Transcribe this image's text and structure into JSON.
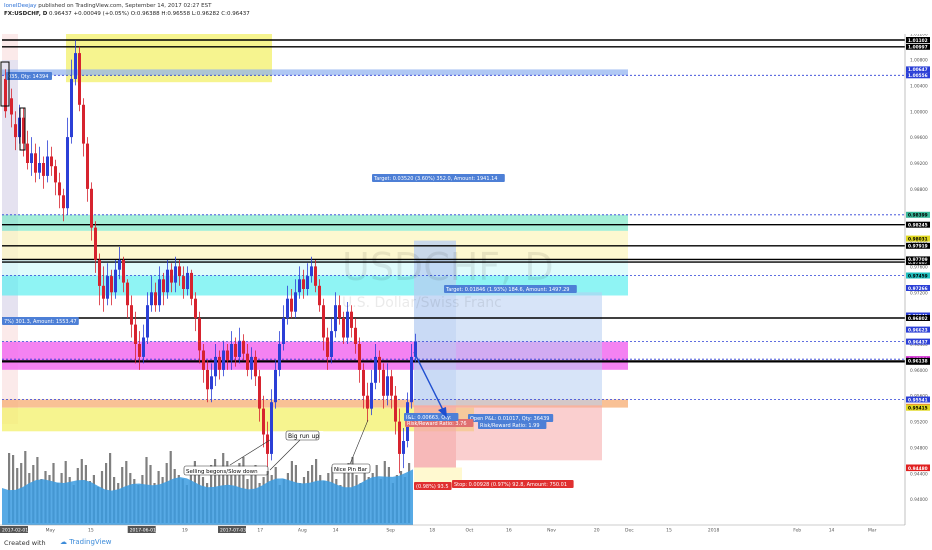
{
  "header": {
    "author": "IonelDeejay",
    "published_text": "published on TradingView.com, September 14, 2017 02:27 EST",
    "symbol_line": "FX:USDCHF, D",
    "open": "0.96437",
    "change": "+0.00049 (+0.05%)",
    "ohlc_open": "O:0.96388",
    "ohlc_high": "H:0.96558",
    "ohlc_low": "L:0.96282",
    "ohlc_close": "C:0.96437"
  },
  "watermark": {
    "symbol": "USDCHF, D",
    "name": "U.S. Dollar/Swiss Franc"
  },
  "chart_data": {
    "type": "candlestick",
    "symbol": "FX:USDCHF",
    "timeframe": "D",
    "y_range": [
      0.936,
      1.0135
    ],
    "y_ticks": [
      "1.01200",
      "1.00800",
      "1.00400",
      "1.00000",
      "0.99600",
      "0.99200",
      "0.98800",
      "0.98400",
      "0.98000",
      "0.97600",
      "0.97200",
      "0.96800",
      "0.96400",
      "0.96000",
      "0.95600",
      "0.95200",
      "0.94800",
      "0.94400",
      "0.94000"
    ],
    "x_ticks": [
      {
        "label": "2017-02-01",
        "pos": 0.0
      },
      {
        "label": "May",
        "pos": 0.07
      },
      {
        "label": "15",
        "pos": 0.138
      },
      {
        "label": "2017-06-01",
        "pos": 0.205
      },
      {
        "label": "19",
        "pos": 0.289
      },
      {
        "label": "2017-07-03",
        "pos": 0.35
      },
      {
        "label": "17",
        "pos": 0.41
      },
      {
        "label": "Aug",
        "pos": 0.475
      },
      {
        "label": "14",
        "pos": 0.531
      },
      {
        "label": "Sep",
        "pos": 0.617
      },
      {
        "label": "18",
        "pos": 0.686
      },
      {
        "label": "Oct",
        "pos": 0.744
      },
      {
        "label": "16",
        "pos": 0.809
      },
      {
        "label": "Nov",
        "pos": 0.875
      },
      {
        "label": "20",
        "pos": 0.95
      },
      {
        "label": "Dec",
        "pos": 1.0
      },
      {
        "label": "15",
        "pos": 1.066
      },
      {
        "label": "2018",
        "pos": 1.133
      },
      {
        "label": "Feb",
        "pos": 1.27
      },
      {
        "label": "14",
        "pos": 1.327
      },
      {
        "label": "Mar",
        "pos": 1.39
      }
    ],
    "price_labels": [
      {
        "value": "1.01102",
        "level": 1.01102,
        "style": "black"
      },
      {
        "value": "1.00997",
        "level": 1.00997,
        "style": "black"
      },
      {
        "value": "1.00647",
        "level": 1.00647,
        "style": "blue"
      },
      {
        "value": "1.00556",
        "level": 1.00556,
        "style": "blue"
      },
      {
        "value": "0.98399",
        "level": 0.98399,
        "style": "teal"
      },
      {
        "value": "0.98245",
        "level": 0.98245,
        "style": "black"
      },
      {
        "value": "0.98031",
        "level": 0.98031,
        "style": "yellow"
      },
      {
        "value": "0.97919",
        "level": 0.97919,
        "style": "black"
      },
      {
        "value": "0.97667",
        "level": 0.97667,
        "style": "black"
      },
      {
        "value": "0.96164",
        "level": 0.96164,
        "style": "magenta"
      },
      {
        "value": "0.96125",
        "level": 0.96125,
        "style": "black"
      },
      {
        "value": "0.97709",
        "level": 0.97709,
        "style": "black"
      },
      {
        "value": "0.97459",
        "level": 0.97459,
        "style": "cyan"
      },
      {
        "value": "0.97266",
        "level": 0.97266,
        "style": "blue"
      },
      {
        "value": "0.96841",
        "level": 0.96841,
        "style": "blue"
      },
      {
        "value": "0.96802",
        "level": 0.96802,
        "style": "black"
      },
      {
        "value": "0.96623",
        "level": 0.96623,
        "style": "blue"
      },
      {
        "value": "0.96437",
        "level": 0.96437,
        "style": "blue"
      },
      {
        "value": "0.96138",
        "level": 0.96138,
        "style": "black"
      },
      {
        "value": "0.95541",
        "level": 0.95541,
        "style": "blue"
      },
      {
        "value": "0.95429",
        "level": 0.95429,
        "style": "orange"
      },
      {
        "value": "0.95415",
        "level": 0.95415,
        "style": "yellow"
      },
      {
        "value": "0.94490",
        "level": 0.9449,
        "style": "red"
      },
      {
        "value": "0.94480",
        "level": 0.9448,
        "style": "red"
      }
    ],
    "annotations": [
      {
        "text": "Target: 0.03520 (3.60%) 352.0, Amount: 1941.14"
      },
      {
        "text": "Target: 0.01846 (1.93%) 184.6, Amount: 1497.29"
      },
      {
        "text": "Open P&L: 0.01017, Qty: 36439"
      },
      {
        "text": "Risk/Reward Ratio: 1.99"
      },
      {
        "text": "Stop: 0.00928 (0.97%) 92.8, Amount: 750.01"
      },
      {
        "text": "(0.98%) 93.5"
      },
      {
        "text": "Big run up"
      },
      {
        "text": "Selling begons/Slow down"
      },
      {
        "text": "Nice Pin Bar"
      },
      {
        "text": "Risk/Reward Ratio: 3.76"
      },
      {
        "text": "I&L: 0.00663, Qty:"
      },
      {
        "text": "7%) 301.3, Amount: 1553.47"
      },
      {
        "text": "035, Qty: 14394"
      }
    ]
  },
  "colors": {
    "bull_candle": "#2b3fd6",
    "bear_candle": "#d6232e",
    "volume": "#7f7f7f",
    "volume_area": "#3a9be0",
    "zone_yellow": "#f3f06a",
    "zone_teal": "#7fe8c8",
    "zone_magenta": "#f26cf0",
    "zone_cyan": "#5ff0f0",
    "zone_blue": "#8fb0f0",
    "zone_orange": "#f7b27a",
    "target_zone": "#b7cdf2",
    "stop_zone": "#f5a8a8"
  },
  "footer": {
    "created_with": "Created with",
    "brand": "TradingView"
  }
}
